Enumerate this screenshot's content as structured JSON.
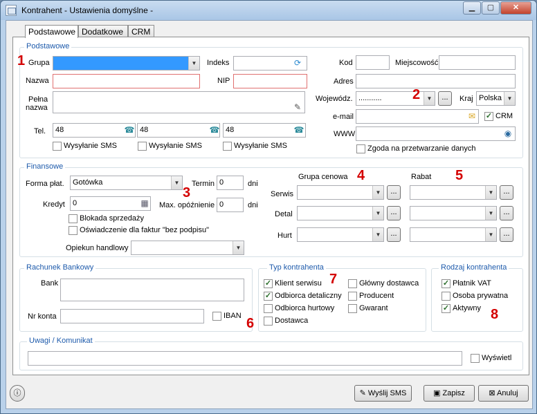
{
  "window": {
    "title": "Kontrahent - Ustawienia domyślne -",
    "minimize": "▁",
    "maximize": "▢",
    "close": "✕"
  },
  "tabs": [
    {
      "label": "Podstawowe"
    },
    {
      "label": "Dodatkowe"
    },
    {
      "label": "CRM"
    }
  ],
  "basic": {
    "legend": "Podstawowe",
    "grupa_label": "Grupa",
    "indeks_label": "Indeks",
    "nazwa_label": "Nazwa",
    "nip_label": "NIP",
    "pelna_label_1": "Pełna",
    "pelna_label_2": "nazwa",
    "tel_label": "Tel.",
    "tel_prefix_1": "48",
    "tel_prefix_2": "48",
    "tel_prefix_3": "48",
    "sms_label": "Wysyłanie SMS",
    "kod_label": "Kod",
    "miejscowosc_label": "Miejscowość",
    "adres_label": "Adres",
    "wojewodztwo_label": "Wojewódz.",
    "wojewodztwo_value": "...........",
    "kraj_label": "Kraj",
    "kraj_value": "Polska",
    "email_label": "e-mail",
    "crm_label": "CRM",
    "www_label": "WWW",
    "zgoda_label": "Zgoda na przetwarzanie danych"
  },
  "finance": {
    "legend": "Finansowe",
    "forma_label": "Forma płat.",
    "forma_value": "Gotówka",
    "termin_label": "Termin",
    "termin_value": "0",
    "dni": "dni",
    "kredyt_label": "Kredyt",
    "kredyt_value": "0",
    "max_label": "Max. opóźnienie",
    "max_value": "0",
    "blokada_label": "Blokada sprzedaży",
    "oswiadczenie_label": "Oświadczenie dla faktur \"bez podpisu\"",
    "opiekun_label": "Opiekun handlowy",
    "grupa_cenowa_label": "Grupa cenowa",
    "rabat_label": "Rabat",
    "serwis_label": "Serwis",
    "detal_label": "Detal",
    "hurt_label": "Hurt",
    "ellipsis": "..."
  },
  "bank": {
    "legend": "Rachunek Bankowy",
    "bank_label": "Bank",
    "nr_label": "Nr konta",
    "iban_label": "IBAN"
  },
  "type": {
    "legend": "Typ kontrahenta",
    "klient": "Klient serwisu",
    "odbiorca_det": "Odbiorca detaliczny",
    "odbiorca_hurt": "Odbiorca hurtowy",
    "dostawca": "Dostawca",
    "glowny": "Główny dostawca",
    "producent": "Producent",
    "gwarant": "Gwarant"
  },
  "kind": {
    "legend": "Rodzaj kontrahenta",
    "platnik": "Płatnik VAT",
    "osoba": "Osoba prywatna",
    "aktywny": "Aktywny"
  },
  "notes": {
    "legend": "Uwagi / Komunikat",
    "wyswietl": "Wyświetl"
  },
  "buttons": {
    "sms": "Wyślij SMS",
    "zapisz": "Zapisz",
    "anuluj": "Anuluj"
  },
  "markers": [
    "1",
    "2",
    "3",
    "4",
    "5",
    "6",
    "7",
    "8"
  ],
  "check": "✓"
}
